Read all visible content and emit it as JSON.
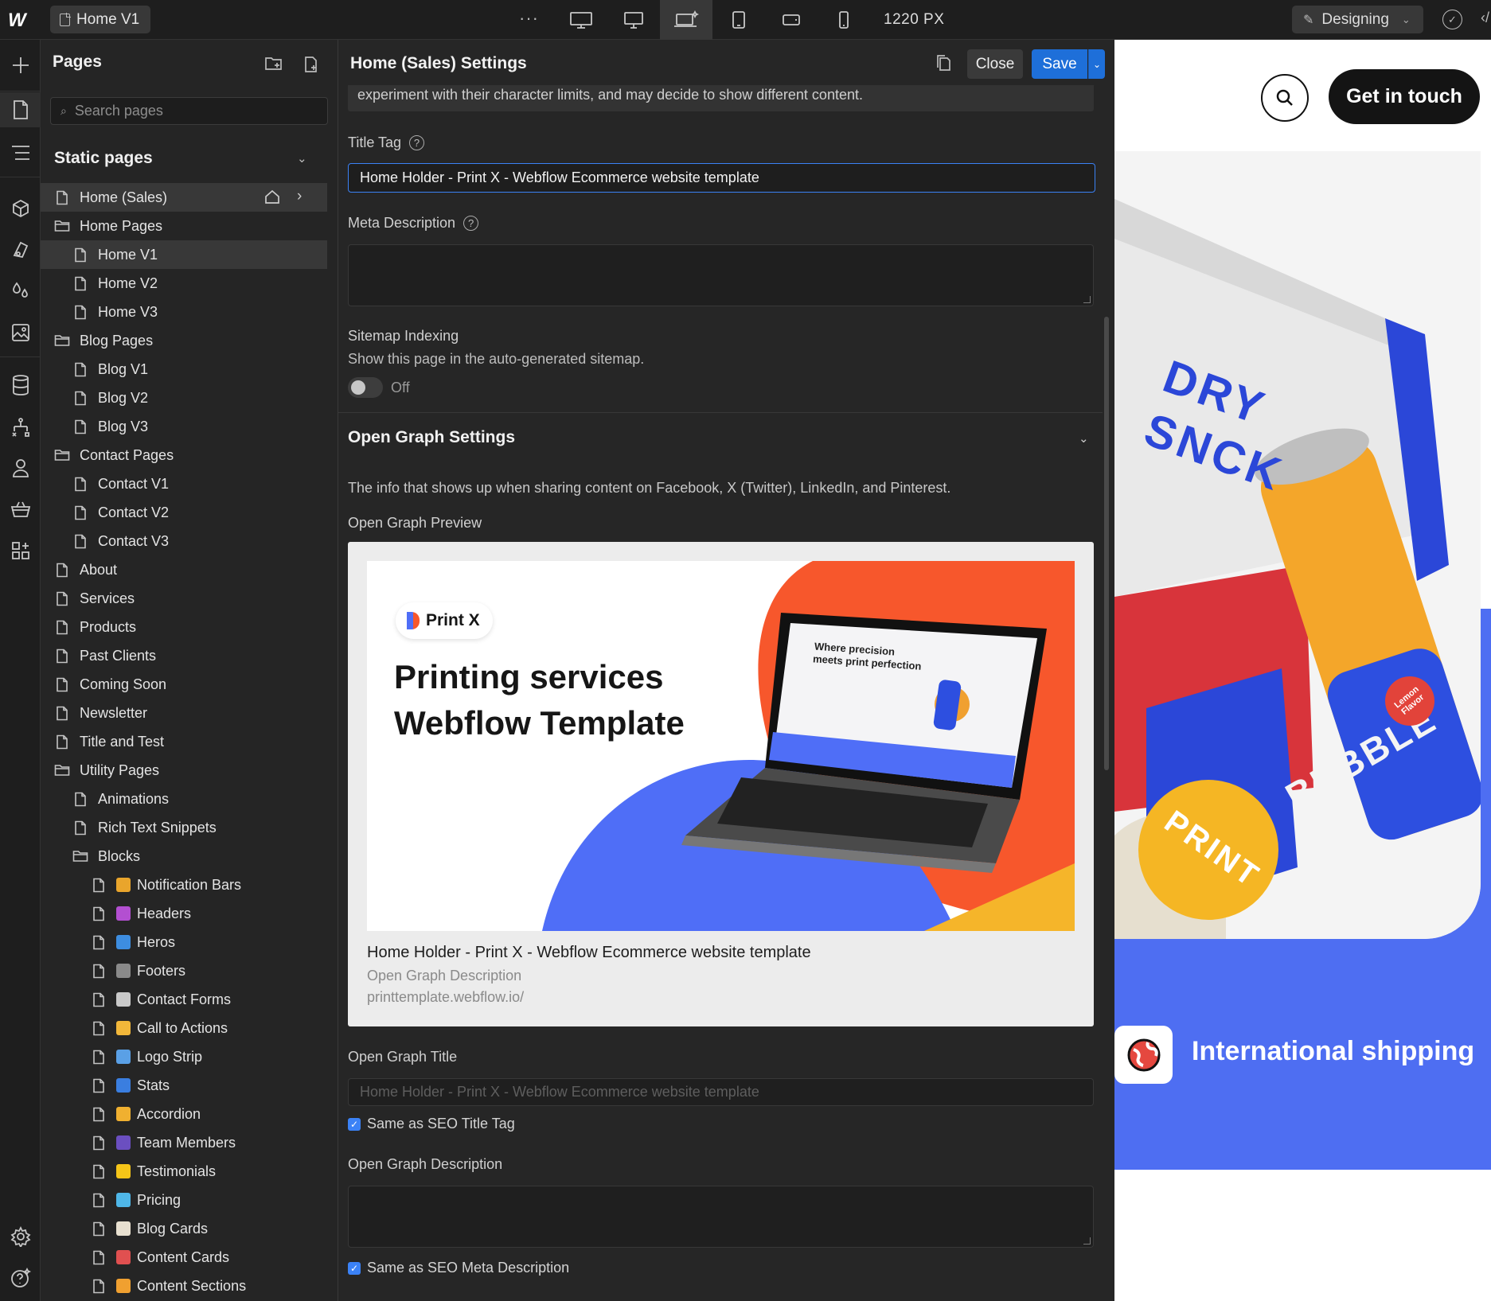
{
  "topbar": {
    "page_name": "Home V1",
    "more": "···",
    "width_label": "1220 PX",
    "mode": "Designing"
  },
  "pages_panel": {
    "title": "Pages",
    "search_placeholder": "Search pages",
    "section": "Static pages",
    "items": [
      {
        "label": "Home (Sales)",
        "type": "doc",
        "indent": 0,
        "selected": true
      },
      {
        "label": "Home Pages",
        "type": "folder",
        "indent": 0
      },
      {
        "label": "Home V1",
        "type": "doc",
        "indent": 1,
        "selected": true
      },
      {
        "label": "Home V2",
        "type": "doc",
        "indent": 1
      },
      {
        "label": "Home V3",
        "type": "doc",
        "indent": 1
      },
      {
        "label": "Blog Pages",
        "type": "folder",
        "indent": 0
      },
      {
        "label": "Blog V1",
        "type": "doc",
        "indent": 1
      },
      {
        "label": "Blog V2",
        "type": "doc",
        "indent": 1
      },
      {
        "label": "Blog V3",
        "type": "doc",
        "indent": 1
      },
      {
        "label": "Contact Pages",
        "type": "folder",
        "indent": 0
      },
      {
        "label": "Contact V1",
        "type": "doc",
        "indent": 1
      },
      {
        "label": "Contact V2",
        "type": "doc",
        "indent": 1
      },
      {
        "label": "Contact V3",
        "type": "doc",
        "indent": 1
      },
      {
        "label": "About",
        "type": "doc",
        "indent": 0
      },
      {
        "label": "Services",
        "type": "doc",
        "indent": 0
      },
      {
        "label": "Products",
        "type": "doc",
        "indent": 0
      },
      {
        "label": "Past Clients",
        "type": "doc",
        "indent": 0
      },
      {
        "label": "Coming Soon",
        "type": "doc",
        "indent": 0
      },
      {
        "label": "Newsletter",
        "type": "doc",
        "indent": 0
      },
      {
        "label": "Title and Test",
        "type": "doc",
        "indent": 0
      },
      {
        "label": "Utility Pages",
        "type": "folder",
        "indent": 0
      },
      {
        "label": "Animations",
        "type": "doc",
        "indent": 1
      },
      {
        "label": "Rich Text Snippets",
        "type": "doc",
        "indent": 1
      },
      {
        "label": "Blocks",
        "type": "folder",
        "indent": 1
      },
      {
        "label": "Notification Bars",
        "type": "doc",
        "indent": 2,
        "emoji_color": "#e9a52c"
      },
      {
        "label": "Headers",
        "type": "doc",
        "indent": 2,
        "emoji_color": "#b34fd1"
      },
      {
        "label": "Heros",
        "type": "doc",
        "indent": 2,
        "emoji_color": "#3d8de0"
      },
      {
        "label": "Footers",
        "type": "doc",
        "indent": 2,
        "emoji_color": "#8a8a8a"
      },
      {
        "label": "Contact Forms",
        "type": "doc",
        "indent": 2,
        "emoji_color": "#c9c9c9"
      },
      {
        "label": "Call to Actions",
        "type": "doc",
        "indent": 2,
        "emoji_color": "#f2b73a"
      },
      {
        "label": "Logo Strip",
        "type": "doc",
        "indent": 2,
        "emoji_color": "#5aa0e6"
      },
      {
        "label": "Stats",
        "type": "doc",
        "indent": 2,
        "emoji_color": "#3a7ee0"
      },
      {
        "label": "Accordion",
        "type": "doc",
        "indent": 2,
        "emoji_color": "#f0b030"
      },
      {
        "label": "Team Members",
        "type": "doc",
        "indent": 2,
        "emoji_color": "#6b4fc0"
      },
      {
        "label": "Testimonials",
        "type": "doc",
        "indent": 2,
        "emoji_color": "#f5c518"
      },
      {
        "label": "Pricing",
        "type": "doc",
        "indent": 2,
        "emoji_color": "#4fb7e8"
      },
      {
        "label": "Blog Cards",
        "type": "doc",
        "indent": 2,
        "emoji_color": "#e8e0d0"
      },
      {
        "label": "Content Cards",
        "type": "doc",
        "indent": 2,
        "emoji_color": "#e05050"
      },
      {
        "label": "Content Sections",
        "type": "doc",
        "indent": 2,
        "emoji_color": "#f0a030"
      }
    ]
  },
  "settings": {
    "title": "Home (Sales) Settings",
    "close": "Close",
    "save": "Save",
    "truncated_text": "experiment with their character limits, and may decide to show different content.",
    "title_tag_label": "Title Tag",
    "title_tag_value": "Home Holder - Print X - Webflow Ecommerce website template",
    "meta_desc_label": "Meta Description",
    "sitemap_label": "Sitemap Indexing",
    "sitemap_sub": "Show this page in the auto-generated sitemap.",
    "sitemap_state": "Off",
    "og_heading": "Open Graph Settings",
    "og_intro": "The info that shows up when sharing content on Facebook, X (Twitter), LinkedIn, and Pinterest.",
    "og_preview_label": "Open Graph Preview",
    "og_preview": {
      "brand": "Print X",
      "headline_1": "Printing services",
      "headline_2": "Webflow Template",
      "laptop_heading_1": "Where precision",
      "laptop_heading_2": "meets print perfection",
      "title": "Home Holder - Print X - Webflow Ecommerce website template",
      "description": "Open Graph Description",
      "url": "printtemplate.webflow.io/"
    },
    "og_title_label": "Open Graph Title",
    "og_title_placeholder": "Home Holder - Print X - Webflow Ecommerce website template",
    "og_title_same": "Same as SEO Title Tag",
    "og_desc_label": "Open Graph Description",
    "og_desc_same": "Same as SEO Meta Description"
  },
  "canvas": {
    "cta": "Get in touch",
    "box_text_1": "DRY",
    "box_text_2": "SNCK",
    "can_text": "BUBBLE",
    "can_tag": "Lemon Flavor",
    "button_text": "PRINT",
    "ship_label": "International shipping"
  },
  "colors": {
    "accent": "#1e6fd9",
    "canvas_blue": "#4e6ef2",
    "og_orange": "#f7572c",
    "og_blue": "#4f6ef7"
  }
}
